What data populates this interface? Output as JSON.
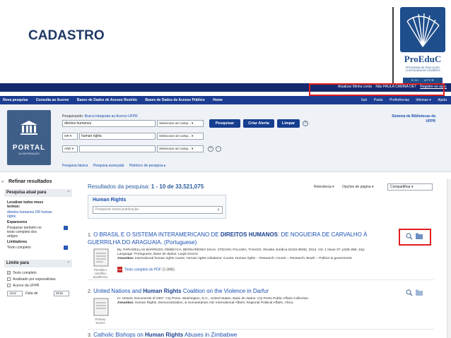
{
  "slide": {
    "title": "CADASTRO",
    "logo_name": "ProEduC",
    "logo_sub": "Programa de Educação Continuada de Usuários",
    "logo_bar": "SIBI · UFPR"
  },
  "topbar": {
    "links": [
      "Atualizar Minha conta",
      "Não PAULA CARINA DE?"
    ],
    "register": "Registre-se aqui."
  },
  "nav": {
    "left": [
      "Nova pesquisa",
      "Consulta ao Acervo",
      "Bases de Dados de Acesso Restrito",
      "Bases de Dados de Acesso Público",
      "Home"
    ],
    "right": [
      "Sair",
      "Pasta",
      "Preferências",
      "Idiomas ▾",
      "Ajuda"
    ]
  },
  "portal": {
    "name": "PORTAL",
    "sub": "DA INFORMAÇÃO"
  },
  "search": {
    "searching_label": "Pesquisando:",
    "searching_target": "Busca Integrada ao Acervo UFPR",
    "row1_value": "direitos humanos",
    "row2_operator": "OR ▾",
    "row2_value": "human rights",
    "row3_operator": "AND ▾",
    "row3_value": "",
    "field_select": "Selecionar um camp... ▾",
    "btn_search": "Pesquisar",
    "btn_alert": "Criar Alerta",
    "btn_clear": "Limpar",
    "help": "?",
    "add": "+",
    "remove": "−",
    "links": [
      "Pesquisa básica",
      "Pesquisa avançada",
      "Histórico de pesquisa ▸"
    ],
    "sys_lib_1": "Sistema de Bibliotecas da",
    "sys_lib_2": "UFPR"
  },
  "sidebar": {
    "arrow": "«",
    "title": "Refinar resultados",
    "current_search": "Pesquisa atual para",
    "find_all_1": "Localizar todos meus",
    "find_all_2": "termos:",
    "terms_1": "direitos humanos OR human",
    "terms_2": "rights",
    "expanders": "Expansores",
    "expander_1a": "Pesquisar também no",
    "expander_1b": "texto completo dos",
    "expander_1c": "artigos",
    "limiters": "Limitadores",
    "limiter_1": "Texto completo",
    "limit_to": "Limite para",
    "check_1": "Texto completo",
    "check_2": "Analisado por especialistas",
    "check_3": "Acervo da UFPR",
    "check_mark": "✓",
    "date_from": "1212",
    "date_label": "Data de",
    "date_to": "2016",
    "info": "i",
    "chevron": "⌃"
  },
  "results": {
    "heading_label": "Resultados da pesquisa:",
    "heading_range": "1 - 10 de 33,521,075",
    "relevance": "Relevância ▾",
    "page_options": "Opções de página ▾",
    "share": "Compartilhar ▾",
    "related_title": "Human Rights",
    "related_placeholder": "Pesquisar nesta publicação",
    "magnifier": "⌕",
    "items": [
      {
        "num": "1.",
        "title_pre": "O BRASIL E O SISTEMA INTERAMERICANO DE",
        "title_bold": "DIREITOS HUMANOS",
        "title_post": ": DE NOGUEIRA DE CARVALHO À",
        "title_line2": "GUERRILHA DO ARAGUAIA. (Portuguese)",
        "meta_1": "By: PARADELLAS BARROZO, REBECCA; BERNARDINO SILVA, STEVAN; PALUMA, THIAGO. Revista Jurídica (0103-3506). 2014, Vol. 1 Issue 37, p335-358. 24p;",
        "meta_2": "Language: Portuguese, Base de dados: Legal Source",
        "meta_3_label": "Assuntos:",
        "meta_3": "International human rights courts; Human rights violations; Courts; Human rights -- Research; Courts -- Research; Brazil -- Politics & government",
        "thumb_label_1": "Periódico",
        "thumb_label_2": "científico",
        "thumb_label_3": "acadêmico",
        "pdf": "Texto completo do PDF",
        "pdf_size": "(3.3MB)",
        "pdf_icon": "PDF"
      },
      {
        "num": "2.",
        "title_pre": "United Nations and",
        "title_bold": "Human Rights",
        "title_post": "Coalition on the Violence in Darfur",
        "meta_1": "In: Historic Documents of 2007. CQ Press. Washington, D.C., United States, Base de dados: CQ Press Public Affairs Collection",
        "meta_2_label": "Assuntos:",
        "meta_2": "Human Rights, Democratization, & Humanitarian Aid; International Affairs; Regional Political Affairs, Africa",
        "thumb_label_1": "Primary",
        "thumb_label_2": "Source"
      },
      {
        "num": "3.",
        "title_pre": "Catholic Bishops on",
        "title_bold": "Human Rights",
        "title_post": "Abuses in Zimbabwe"
      }
    ]
  }
}
